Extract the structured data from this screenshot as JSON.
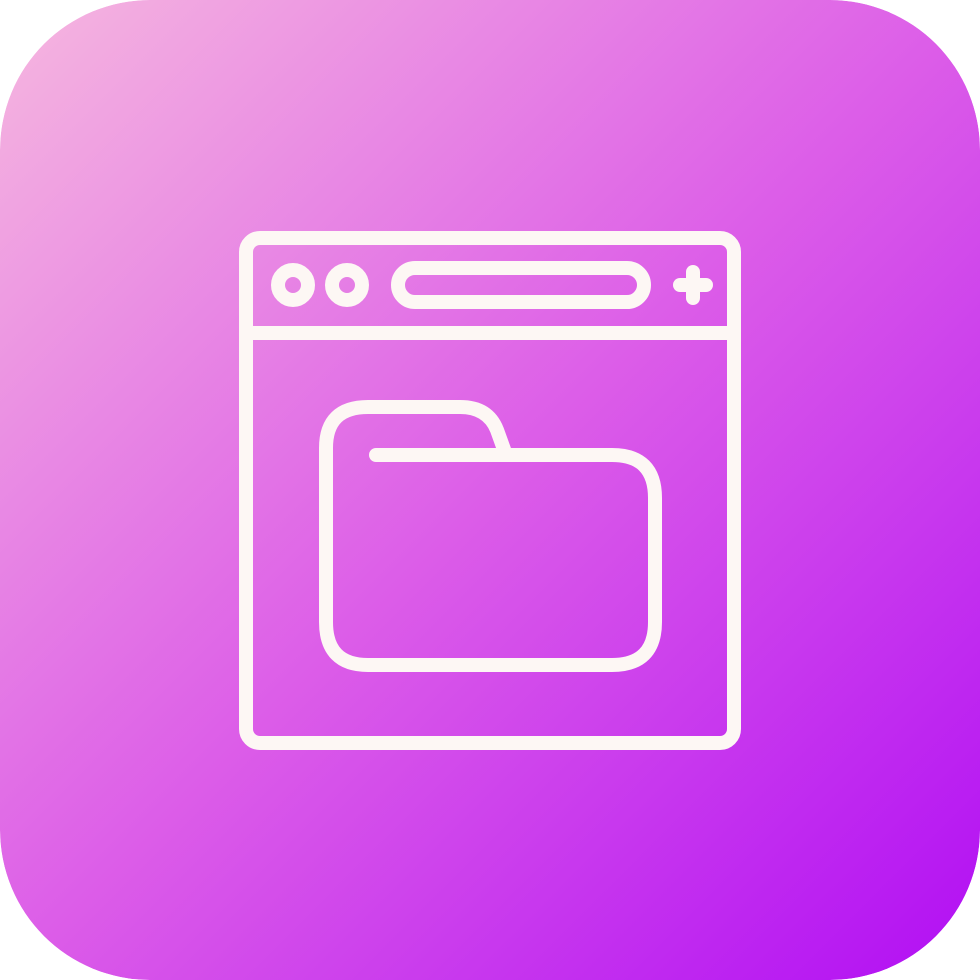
{
  "icon": {
    "name": "browser-folder-icon",
    "stroke_color": "#fdf7f4",
    "gradient": {
      "start_color": "#f6b8df",
      "mid_color": "#dc5de8",
      "end_color": "#b10ef4"
    },
    "parts": {
      "window": "browser-window-icon",
      "dots": "window-dot-icon",
      "address_bar": "address-bar-icon",
      "plus": "plus-icon",
      "folder": "folder-icon"
    }
  }
}
